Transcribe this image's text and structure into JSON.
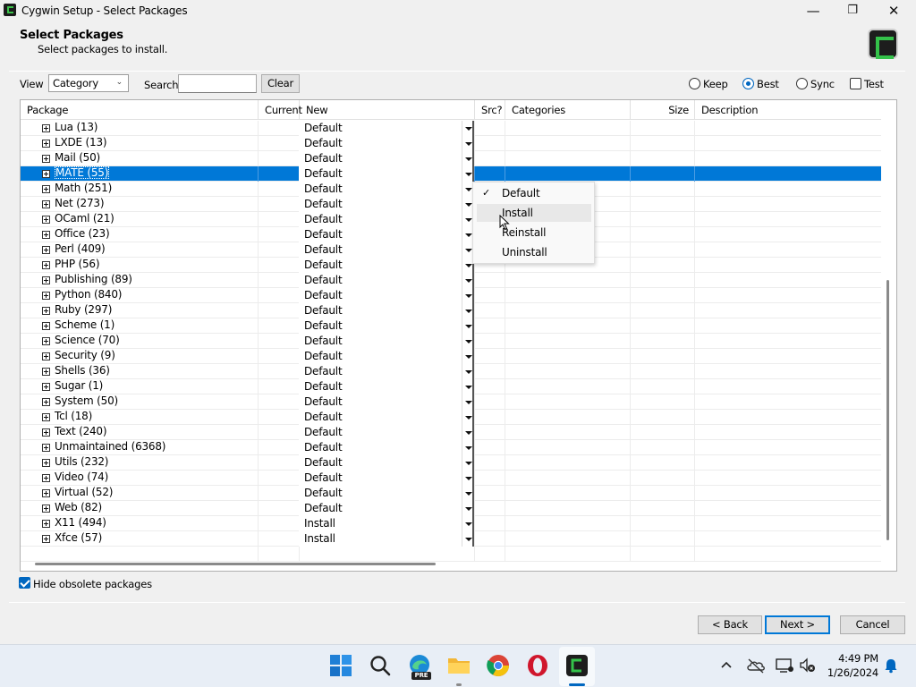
{
  "window": {
    "title": "Cygwin Setup - Select Packages",
    "minimize": "—",
    "maximize": "❐",
    "close": "✕"
  },
  "header": {
    "title": "Select Packages",
    "subtitle": "Select packages to install."
  },
  "toolbar": {
    "view_label": "View",
    "view_value": "Category",
    "search_label": "Search",
    "search_value": "",
    "clear_label": "Clear",
    "modes": [
      {
        "label": "Keep",
        "selected": false
      },
      {
        "label": "Best",
        "selected": true
      },
      {
        "label": "Sync",
        "selected": false
      }
    ],
    "test_label": "Test"
  },
  "grid": {
    "columns": [
      "Package",
      "Current",
      "New",
      "Src?",
      "Categories",
      "Size",
      "Description"
    ],
    "rows": [
      {
        "package": "Lua (13)",
        "new": "Default"
      },
      {
        "package": "LXDE (13)",
        "new": "Default"
      },
      {
        "package": "Mail (50)",
        "new": "Default"
      },
      {
        "package": "MATE (55)",
        "new": "Default",
        "selected": true
      },
      {
        "package": "Math (251)",
        "new": "Default"
      },
      {
        "package": "Net (273)",
        "new": "Default"
      },
      {
        "package": "OCaml (21)",
        "new": "Default"
      },
      {
        "package": "Office (23)",
        "new": "Default"
      },
      {
        "package": "Perl (409)",
        "new": "Default"
      },
      {
        "package": "PHP (56)",
        "new": "Default"
      },
      {
        "package": "Publishing (89)",
        "new": "Default"
      },
      {
        "package": "Python (840)",
        "new": "Default"
      },
      {
        "package": "Ruby (297)",
        "new": "Default"
      },
      {
        "package": "Scheme (1)",
        "new": "Default"
      },
      {
        "package": "Science (70)",
        "new": "Default"
      },
      {
        "package": "Security (9)",
        "new": "Default"
      },
      {
        "package": "Shells (36)",
        "new": "Default"
      },
      {
        "package": "Sugar (1)",
        "new": "Default"
      },
      {
        "package": "System (50)",
        "new": "Default"
      },
      {
        "package": "Tcl (18)",
        "new": "Default"
      },
      {
        "package": "Text (240)",
        "new": "Default"
      },
      {
        "package": "Unmaintained (6368)",
        "new": "Default"
      },
      {
        "package": "Utils (232)",
        "new": "Default"
      },
      {
        "package": "Video (74)",
        "new": "Default"
      },
      {
        "package": "Virtual (52)",
        "new": "Default"
      },
      {
        "package": "Web (82)",
        "new": "Default"
      },
      {
        "package": "X11 (494)",
        "new": "Install"
      },
      {
        "package": "Xfce (57)",
        "new": "Install"
      }
    ]
  },
  "popup": {
    "items": [
      {
        "label": "Default",
        "checked": true
      },
      {
        "label": "Install",
        "hover": true
      },
      {
        "label": "Reinstall"
      },
      {
        "label": "Uninstall"
      }
    ],
    "check_mark": "✓"
  },
  "footer": {
    "hide_obsolete_label": "Hide obsolete packages",
    "back_label": "< Back",
    "next_label": "Next >",
    "cancel_label": "Cancel"
  },
  "taskbar": {
    "time": "4:49 PM",
    "date": "1/26/2024",
    "edge_badge": "PRE"
  },
  "colors": {
    "selection": "#0078d7",
    "accent": "#0067c0",
    "cygwin_green": "#34c24a"
  }
}
